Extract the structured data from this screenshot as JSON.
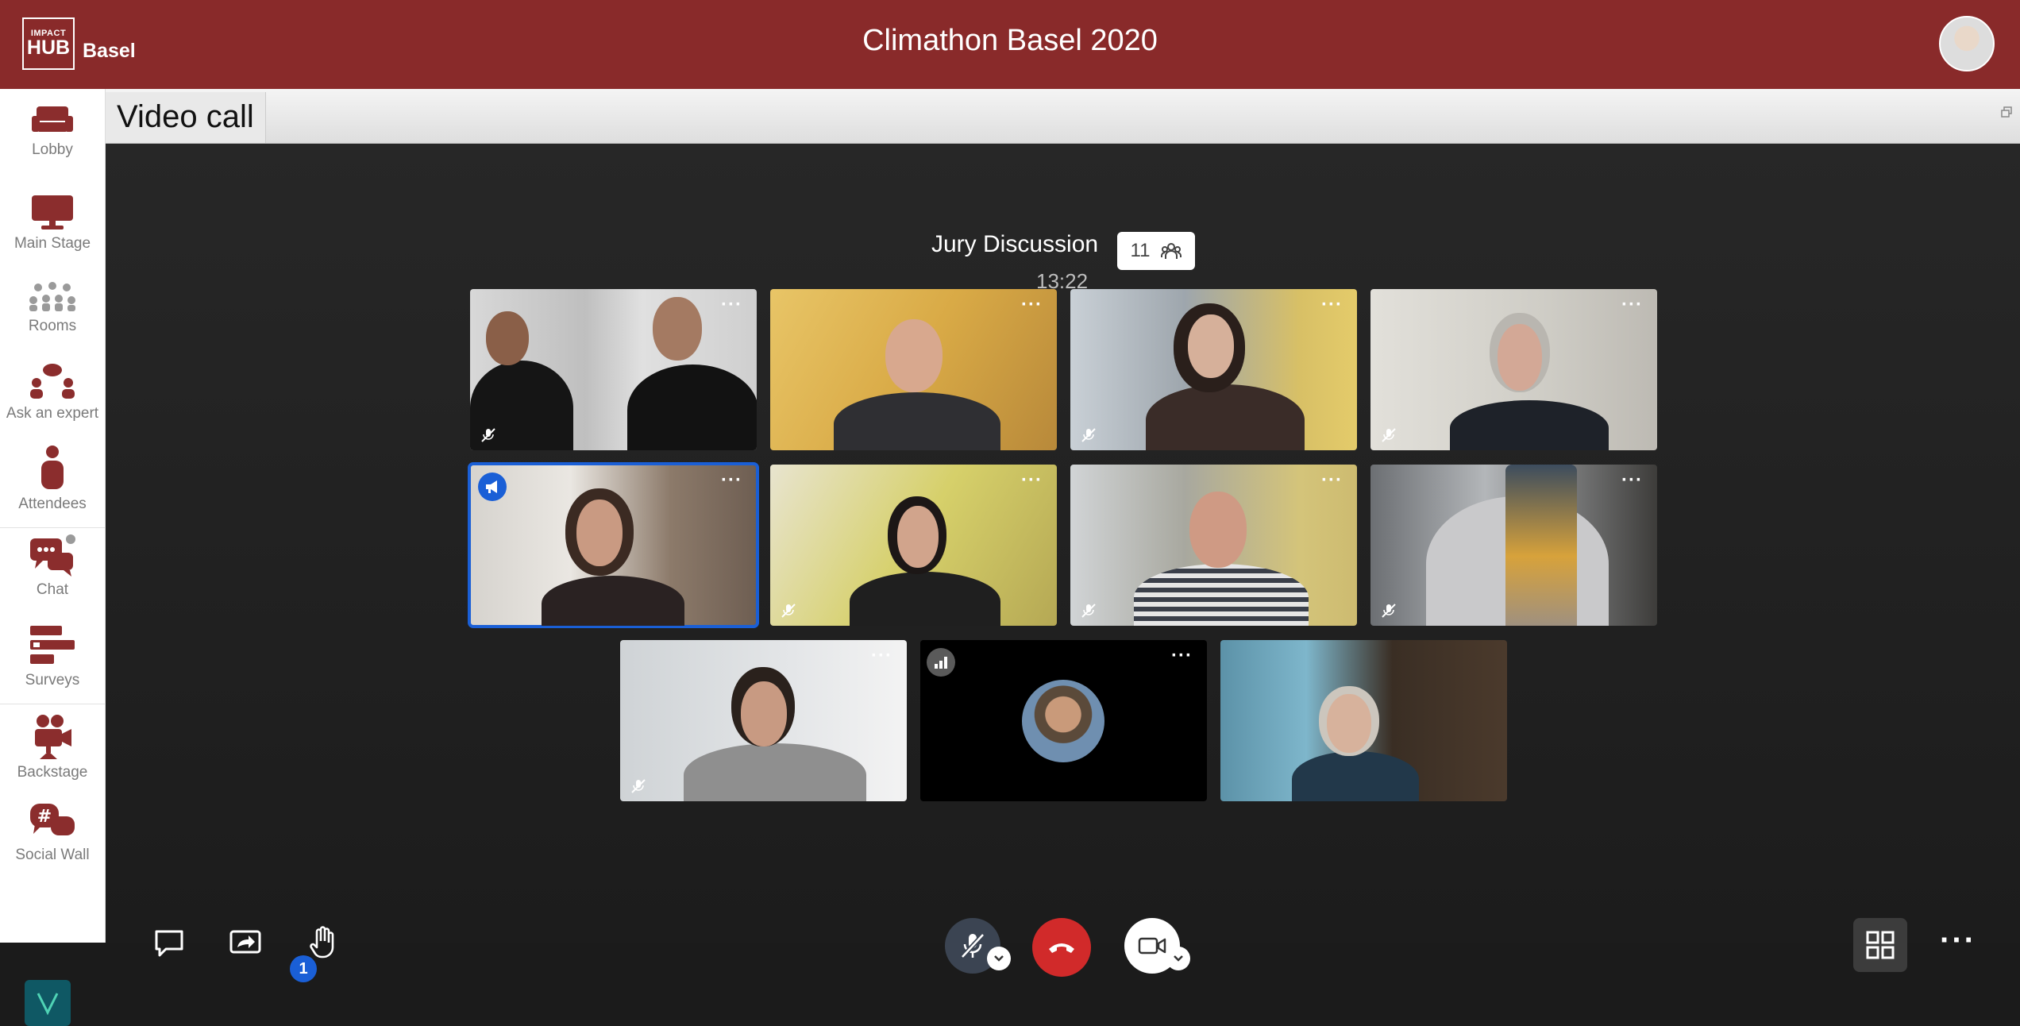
{
  "header": {
    "logo_top": "IMPACT",
    "logo_main": "HUB",
    "logo_city": "Basel",
    "title": "Climathon Basel 2020"
  },
  "sidebar": {
    "items": [
      {
        "label": "Lobby",
        "icon": "sofa-icon"
      },
      {
        "label": "Main Stage",
        "icon": "monitor-icon"
      },
      {
        "label": "Rooms",
        "icon": "people-group-icon"
      },
      {
        "label": "Ask an expert",
        "icon": "speech-people-icon"
      },
      {
        "label": "Attendees",
        "icon": "person-icon"
      },
      {
        "label": "Chat",
        "icon": "chat-bubbles-icon"
      },
      {
        "label": "Surveys",
        "icon": "survey-list-icon"
      },
      {
        "label": "Backstage",
        "icon": "video-camera-icon"
      },
      {
        "label": "Social Wall",
        "icon": "hashtag-chat-icon"
      }
    ]
  },
  "tab": {
    "label": "Video call"
  },
  "call": {
    "room_name": "Jury Discussion",
    "participant_count": "11",
    "elapsed": "13:22",
    "more_label": "···"
  },
  "toolbar": {
    "chat_unread": "1",
    "mic_state": "muted",
    "camera_state": "on"
  },
  "colors": {
    "header_bg": "#892a2a",
    "accent_blue": "#1a5fd6",
    "hangup_red": "#d12a2a"
  }
}
